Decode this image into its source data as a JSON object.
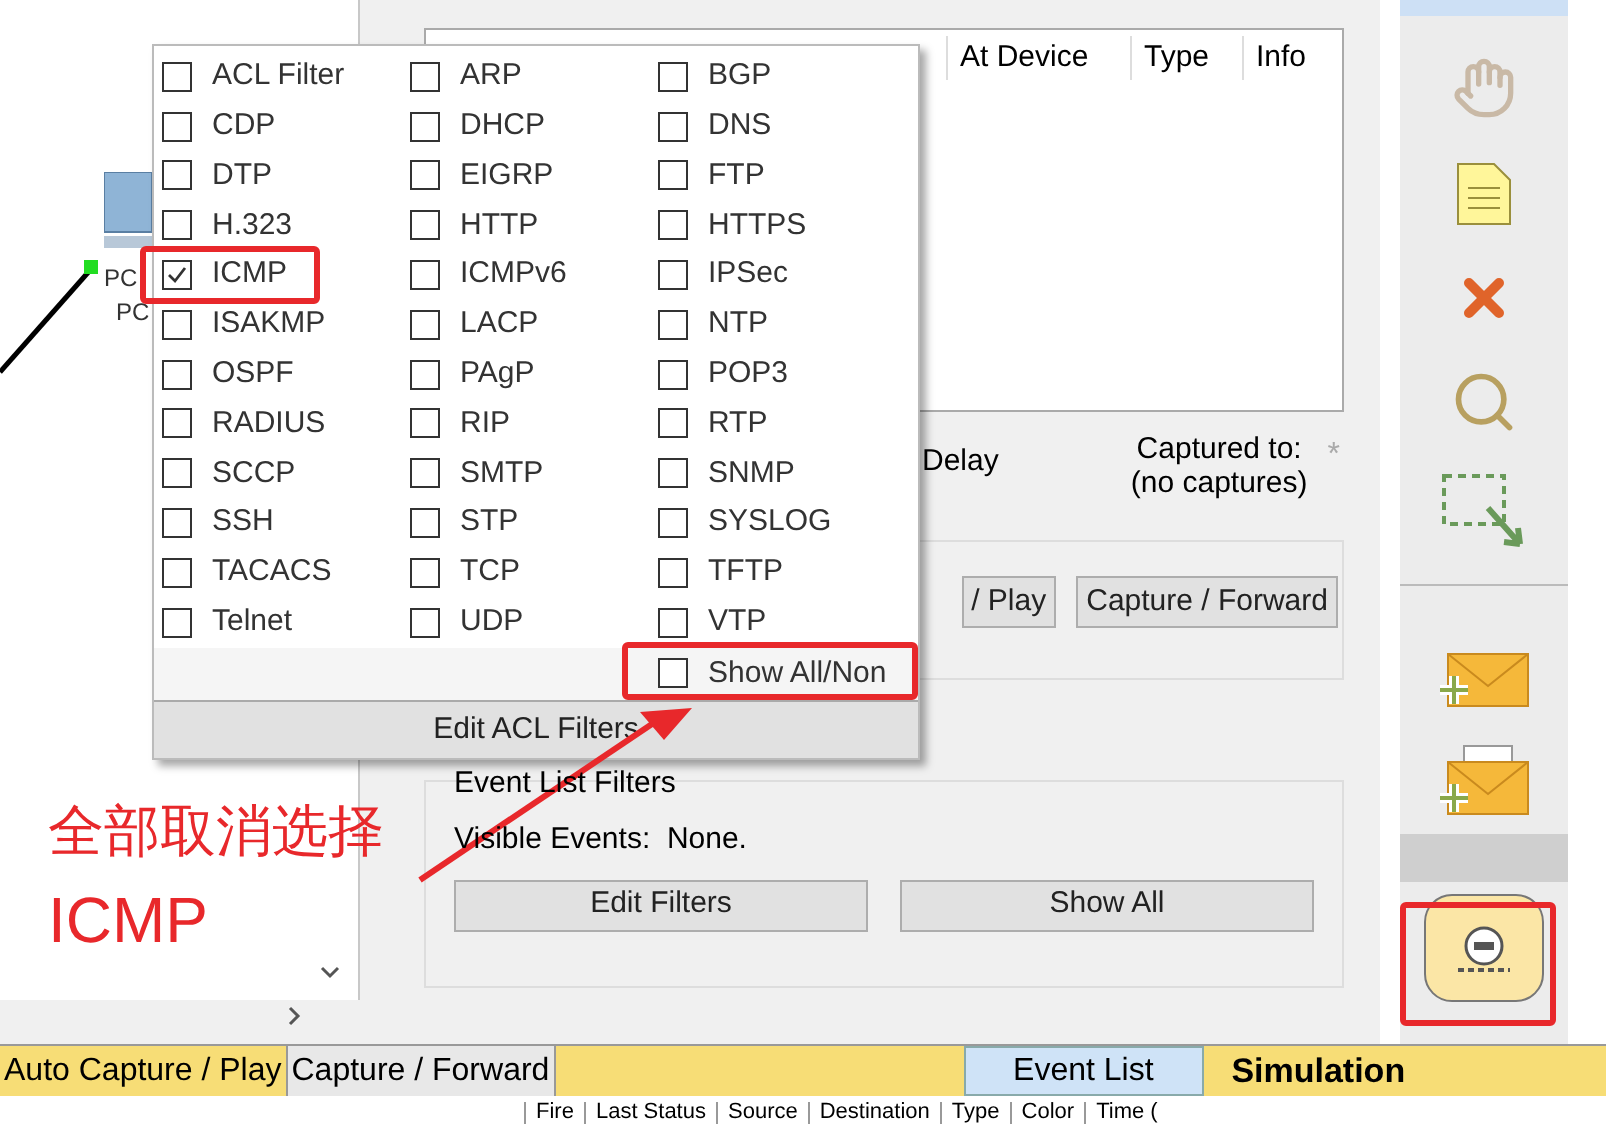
{
  "canvas": {
    "device_labels": [
      "PC",
      "PC"
    ]
  },
  "event_list": {
    "columns": [
      "At Device",
      "Type",
      "Info"
    ],
    "delay_label": "Delay",
    "captured_label": "Captured to:",
    "captured_value": "(no captures)",
    "star": "*"
  },
  "play_controls": {
    "buttons": [
      "/ Play",
      "Capture / Forward"
    ]
  },
  "event_filters": {
    "title": "Event List Filters",
    "visible_events": "Visible Events:  None.",
    "buttons": [
      "Edit Filters",
      "Show All"
    ]
  },
  "filter_menu": {
    "columns": [
      [
        {
          "label": "ACL Filter",
          "checked": false
        },
        {
          "label": "CDP",
          "checked": false
        },
        {
          "label": "DTP",
          "checked": false
        },
        {
          "label": "H.323",
          "checked": false
        },
        {
          "label": "ICMP",
          "checked": true
        },
        {
          "label": "ISAKMP",
          "checked": false
        },
        {
          "label": "OSPF",
          "checked": false
        },
        {
          "label": "RADIUS",
          "checked": false
        },
        {
          "label": "SCCP",
          "checked": false
        },
        {
          "label": "SSH",
          "checked": false
        },
        {
          "label": "TACACS",
          "checked": false
        },
        {
          "label": "Telnet",
          "checked": false
        }
      ],
      [
        {
          "label": "ARP",
          "checked": false
        },
        {
          "label": "DHCP",
          "checked": false
        },
        {
          "label": "EIGRP",
          "checked": false
        },
        {
          "label": "HTTP",
          "checked": false
        },
        {
          "label": "ICMPv6",
          "checked": false
        },
        {
          "label": "LACP",
          "checked": false
        },
        {
          "label": "PAgP",
          "checked": false
        },
        {
          "label": "RIP",
          "checked": false
        },
        {
          "label": "SMTP",
          "checked": false
        },
        {
          "label": "STP",
          "checked": false
        },
        {
          "label": "TCP",
          "checked": false
        },
        {
          "label": "UDP",
          "checked": false
        }
      ],
      [
        {
          "label": "BGP",
          "checked": false
        },
        {
          "label": "DNS",
          "checked": false
        },
        {
          "label": "FTP",
          "checked": false
        },
        {
          "label": "HTTPS",
          "checked": false
        },
        {
          "label": "IPSec",
          "checked": false
        },
        {
          "label": "NTP",
          "checked": false
        },
        {
          "label": "POP3",
          "checked": false
        },
        {
          "label": "RTP",
          "checked": false
        },
        {
          "label": "SNMP",
          "checked": false
        },
        {
          "label": "SYSLOG",
          "checked": false
        },
        {
          "label": "TFTP",
          "checked": false
        },
        {
          "label": "VTP",
          "checked": false
        }
      ]
    ],
    "show_all": {
      "label": "Show All/Non",
      "checked": false
    },
    "edit_button": "Edit ACL Filters"
  },
  "annotation": {
    "lines": [
      "全部取消选择",
      "ICMP"
    ]
  },
  "bottom_bar": {
    "tabs": [
      {
        "label": "Auto Capture / Play",
        "selected": true
      },
      {
        "label": "Capture / Forward",
        "selected": false
      }
    ],
    "event_list_tab": "Event List",
    "mode": "Simulation"
  },
  "event_table_header": [
    "Fire",
    "Last Status",
    "Source",
    "Destination",
    "Type",
    "Color",
    "Time ("
  ]
}
